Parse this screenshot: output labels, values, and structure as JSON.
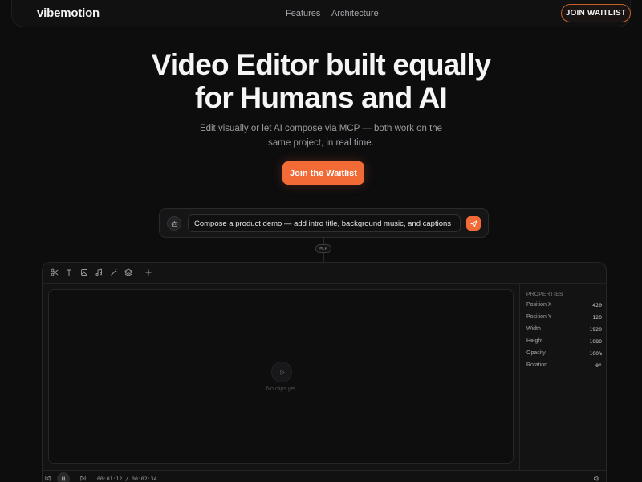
{
  "nav": {
    "logo": "vibemotion",
    "links": [
      "Features",
      "Architecture"
    ],
    "cta": "JOIN WAITLIST"
  },
  "hero": {
    "title_line1": "Video Editor built equally",
    "title_line2": "for Humans and AI",
    "subtitle_line1": "Edit visually or let AI compose via MCP — both work on the",
    "subtitle_line2": "same project, in real time.",
    "cta": "Join the Waitlist"
  },
  "prompt": {
    "value": "Compose a product demo — add intro title, background music, and captions",
    "connector_badge": "MCP"
  },
  "editor": {
    "toolbar_icons": [
      "scissors-icon",
      "text-icon",
      "image-icon",
      "music-icon",
      "magic-wand-icon",
      "layers-icon",
      "plus-icon"
    ],
    "canvas_empty": "No clips yet",
    "properties": {
      "title": "PROPERTIES",
      "rows": [
        {
          "label": "Position X",
          "value": "420"
        },
        {
          "label": "Position Y",
          "value": "120"
        },
        {
          "label": "Width",
          "value": "1920"
        },
        {
          "label": "Height",
          "value": "1080"
        },
        {
          "label": "Opacity",
          "value": "100%"
        },
        {
          "label": "Rotation",
          "value": "0°"
        }
      ]
    },
    "timeline": {
      "time": "00:01:12 / 00:02:34"
    }
  },
  "colors": {
    "background": "#0d0d0e",
    "accent": "#f26a36",
    "panel": "#131314"
  }
}
